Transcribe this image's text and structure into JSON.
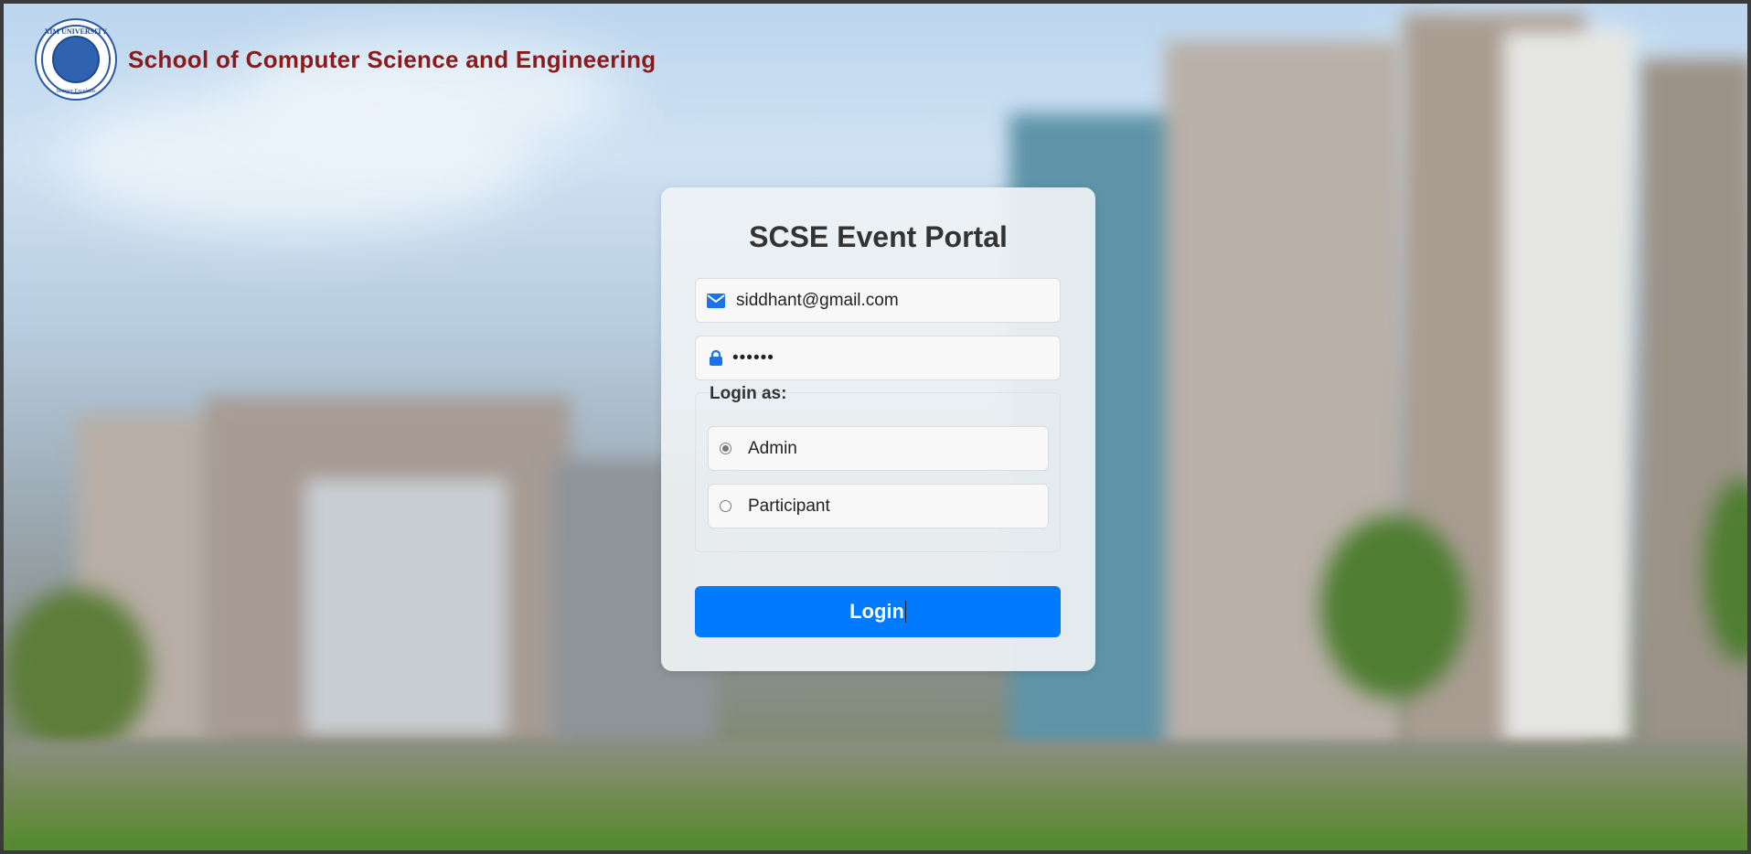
{
  "header": {
    "logo_text_top": "XIM UNIVERSITY",
    "logo_text_bottom": "Semper Excelsius",
    "site_title": "School of Computer Science and Engineering"
  },
  "login": {
    "title": "SCSE Event Portal",
    "email_value": "siddhant@gmail.com",
    "password_display": "••••••",
    "login_as_label": "Login as:",
    "options": [
      {
        "label": "Admin",
        "selected": true
      },
      {
        "label": "Participant",
        "selected": false
      }
    ],
    "button_label": "Login"
  },
  "colors": {
    "brand_red": "#8b1a1a",
    "primary_blue": "#007bff",
    "icon_blue": "#1a73e8"
  }
}
